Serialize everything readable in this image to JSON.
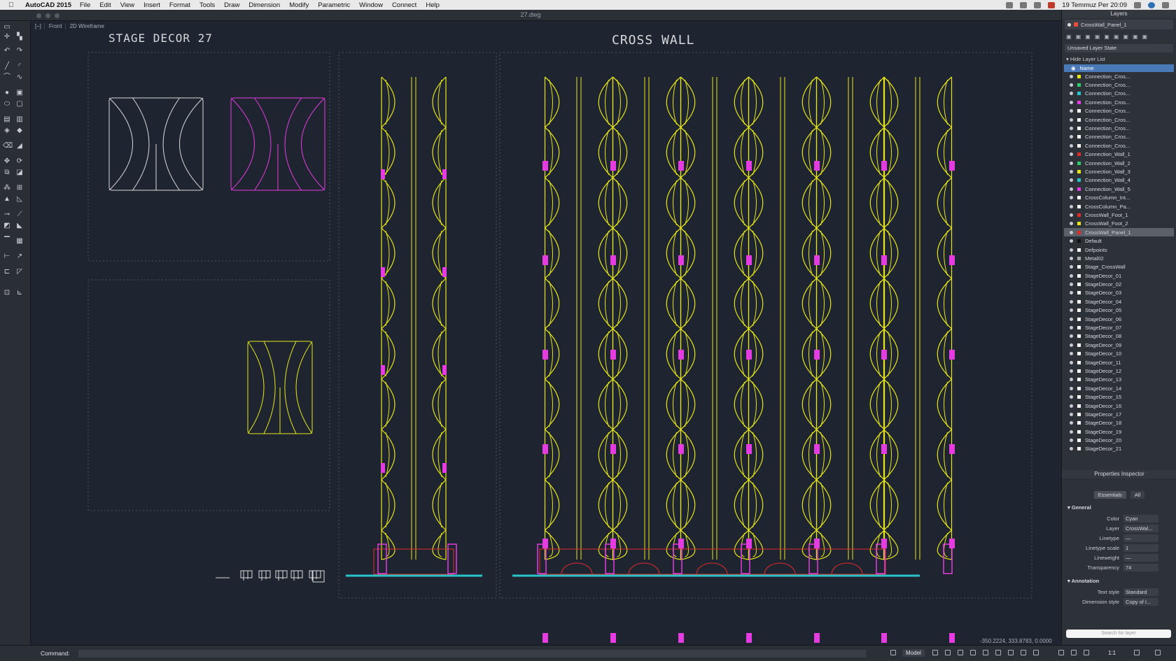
{
  "menubar": {
    "app_name": "AutoCAD 2015",
    "items": [
      "File",
      "Edit",
      "View",
      "Insert",
      "Format",
      "Tools",
      "Draw",
      "Dimension",
      "Modify",
      "Parametric",
      "Window",
      "Connect",
      "Help"
    ],
    "clock": "19 Temmuz Per 20:09"
  },
  "window": {
    "title": "27.dwg"
  },
  "viewport": {
    "view_label": "Front",
    "visual_style": "2D Wireframe",
    "title_left": "STAGE DECOR 27",
    "title_right": "CROSS WALL",
    "coordinates": "-350.2224, 333.8783, 0.0000"
  },
  "colors": {
    "background": "#1f2530",
    "yellow_lines": "#e6e61a",
    "magenta": "#e43ce0",
    "white_lines": "#d9d9d9",
    "cyan_base": "#27c4c9",
    "red_frame": "#e02b2b"
  },
  "layers_panel": {
    "title": "Layers",
    "current_layer": "CrossWall_Panel_1",
    "layer_state": "Unsaved Layer State",
    "hide_list": "Hide Layer List",
    "column_name": "Name",
    "layers": [
      {
        "name": "Connection_Cros...",
        "color": "#e6e61a"
      },
      {
        "name": "Connection_Cros...",
        "color": "#2ecc71"
      },
      {
        "name": "Connection_Cros...",
        "color": "#27c4c9"
      },
      {
        "name": "Connection_Cros...",
        "color": "#e43ce0"
      },
      {
        "name": "Connection_Cros...",
        "color": "#ffffff"
      },
      {
        "name": "Connection_Cros...",
        "color": "#ffffff"
      },
      {
        "name": "Connection_Cros...",
        "color": "#ffffff"
      },
      {
        "name": "Connection_Cros...",
        "color": "#ffffff"
      },
      {
        "name": "Connection_Cros...",
        "color": "#ffffff"
      },
      {
        "name": "Connection_Wall_1",
        "color": "#e02b2b"
      },
      {
        "name": "Connection_Wall_2",
        "color": "#2ecc71"
      },
      {
        "name": "Connection_Wall_3",
        "color": "#e6e61a"
      },
      {
        "name": "Connection_Wall_4",
        "color": "#27c4c9"
      },
      {
        "name": "Connection_Wall_5",
        "color": "#e43ce0"
      },
      {
        "name": "CrossColumn_Int...",
        "color": "#ffffff"
      },
      {
        "name": "CrossColumn_Pa...",
        "color": "#ffffff"
      },
      {
        "name": "CrossWall_Foot_1",
        "color": "#e02b2b"
      },
      {
        "name": "CrossWall_Foot_2",
        "color": "#e6e61a"
      },
      {
        "name": "CrossWall_Panel_1",
        "color": "#e02b2b"
      },
      {
        "name": "Default",
        "color": "#111111"
      },
      {
        "name": "Defpoints",
        "color": "#ffffff"
      },
      {
        "name": "Metal02",
        "color": "#aaaaaa"
      },
      {
        "name": "Stage_CrossWall",
        "color": "#ffffff"
      },
      {
        "name": "StageDecor_01",
        "color": "#ffffff"
      },
      {
        "name": "StageDecor_02",
        "color": "#ffffff"
      },
      {
        "name": "StageDecor_03",
        "color": "#ffffff"
      },
      {
        "name": "StageDecor_04",
        "color": "#ffffff"
      },
      {
        "name": "StageDecor_05",
        "color": "#ffffff"
      },
      {
        "name": "StageDecor_06",
        "color": "#ffffff"
      },
      {
        "name": "StageDecor_07",
        "color": "#ffffff"
      },
      {
        "name": "StageDecor_08",
        "color": "#ffffff"
      },
      {
        "name": "StageDecor_09",
        "color": "#ffffff"
      },
      {
        "name": "StageDecor_10",
        "color": "#ffffff"
      },
      {
        "name": "StageDecor_11",
        "color": "#ffffff"
      },
      {
        "name": "StageDecor_12",
        "color": "#ffffff"
      },
      {
        "name": "StageDecor_13",
        "color": "#ffffff"
      },
      {
        "name": "StageDecor_14",
        "color": "#ffffff"
      },
      {
        "name": "StageDecor_15",
        "color": "#ffffff"
      },
      {
        "name": "StageDecor_16",
        "color": "#ffffff"
      },
      {
        "name": "StageDecor_17",
        "color": "#ffffff"
      },
      {
        "name": "StageDecor_18",
        "color": "#ffffff"
      },
      {
        "name": "StageDecor_19",
        "color": "#ffffff"
      },
      {
        "name": "StageDecor_20",
        "color": "#ffffff"
      },
      {
        "name": "StageDecor_21",
        "color": "#ffffff"
      }
    ]
  },
  "properties": {
    "title": "Properties Inspector",
    "tab_essentials": "Essentials",
    "tab_all": "All",
    "section_general": "General",
    "section_annotation": "Annotation",
    "rows": [
      {
        "label": "Color",
        "value": "Cyan"
      },
      {
        "label": "Layer",
        "value": "CrossWal..."
      },
      {
        "label": "Linetype",
        "value": "—"
      },
      {
        "label": "Linetype scale",
        "value": "1"
      },
      {
        "label": "Lineweight",
        "value": "—"
      },
      {
        "label": "Transparency",
        "value": "74"
      }
    ],
    "annotation_rows": [
      {
        "label": "Text style",
        "value": "Standard"
      },
      {
        "label": "Dimension style",
        "value": "Copy of I..."
      }
    ],
    "search_placeholder": "Search for layer"
  },
  "command": {
    "label": "Command:"
  },
  "status": {
    "model": "Model",
    "scale": "1:1"
  }
}
